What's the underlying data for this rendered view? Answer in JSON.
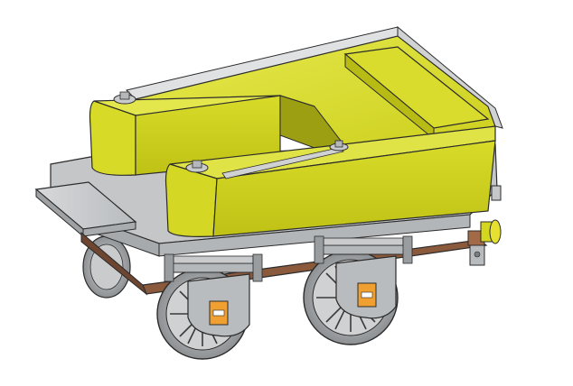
{
  "scene": {
    "subject": "tender-wagon-3d-model",
    "colors": {
      "background": "#ffffff",
      "tank_yellow": "#cfd21a",
      "tank_yellow_light": "#e3e64a",
      "tank_yellow_shadow": "#a9ab14",
      "frame_gray": "#c4c6c8",
      "frame_gray_dark": "#8d9093",
      "frame_gray_light": "#dfe1e3",
      "chassis_brown": "#8b5a3c",
      "chassis_brown_dark": "#5e3b26",
      "axlebox_orange": "#f0a030",
      "buffer_yellow": "#e6e030",
      "wheel_gray": "#b9bcbf",
      "outline": "#2b2b2b"
    }
  }
}
